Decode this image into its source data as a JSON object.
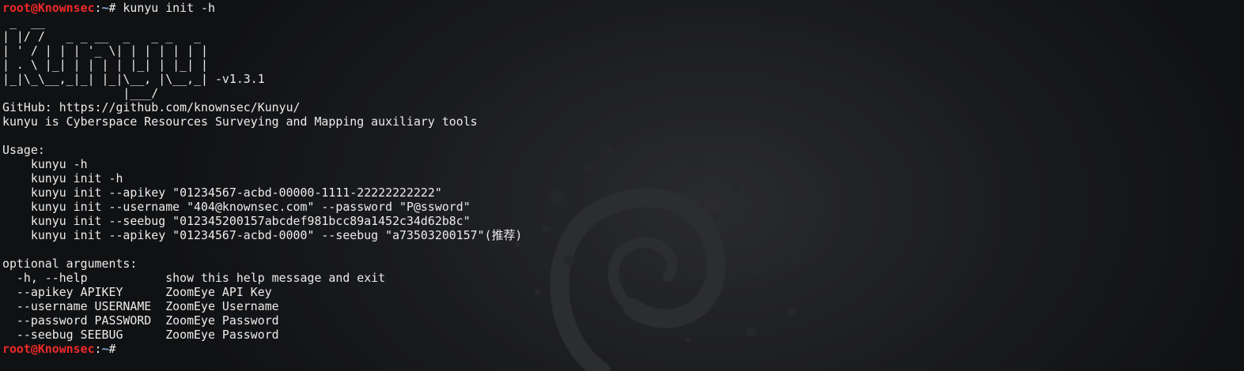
{
  "prompt": {
    "user_host": "root@Knownsec",
    "colon": ":",
    "path": "~",
    "symbol": "# "
  },
  "command": "kunyu init -h",
  "banner": [
    " _  __",
    "| |/ /   _ _ __  _   _ _   _",
    "| ' / | | | '_ \\| | | | | | |",
    "| . \\ |_| | | | | |_| | |_| |",
    "|_|\\_\\__,_|_| |_|\\__, |\\__,_| -v1.3.1",
    "                 |___/"
  ],
  "github_line": "GitHub: https://github.com/knownsec/Kunyu/",
  "description": "kunyu is Cyberspace Resources Surveying and Mapping auxiliary tools",
  "usage": {
    "header": "Usage:",
    "lines": [
      "    kunyu -h",
      "    kunyu init -h",
      "    kunyu init --apikey \"01234567-acbd-00000-1111-22222222222\"",
      "    kunyu init --username \"404@knownsec.com\" --password \"P@ssword\"",
      "    kunyu init --seebug \"012345200157abcdef981bcc89a1452c34d62b8c\"",
      "    kunyu init --apikey \"01234567-acbd-0000\" --seebug \"a73503200157\"(推荐)"
    ]
  },
  "optional": {
    "header": "optional arguments:",
    "lines": [
      "  -h, --help           show this help message and exit",
      "  --apikey APIKEY      ZoomEye API Key",
      "  --username USERNAME  ZoomEye Username",
      "  --password PASSWORD  ZoomEye Password",
      "  --seebug SEEBUG      ZoomEye Password"
    ]
  },
  "colors": {
    "background": "#101113",
    "text": "#ececec",
    "prompt_user": "#ef2929",
    "prompt_path": "#7fa7d9",
    "wallpaper_swirl": "#2c2d30"
  }
}
